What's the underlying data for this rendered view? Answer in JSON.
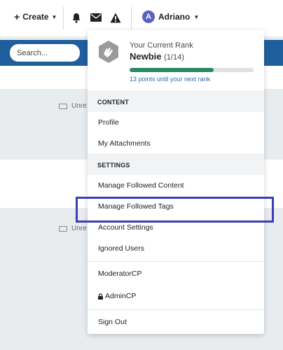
{
  "topbar": {
    "create_label": "Create",
    "username": "Adriano",
    "avatar_letter": "A"
  },
  "search": {
    "placeholder": "Search..."
  },
  "background": {
    "unread_label_1": "Unre",
    "unread_label_2": "Unre"
  },
  "rank": {
    "subtitle": "Your Current Rank",
    "name": "Newbie",
    "fraction": "(1/14)",
    "progress": 0.68,
    "next_text": "13 points until your next rank"
  },
  "menu": {
    "content_heading": "CONTENT",
    "profile": "Profile",
    "attachments": "My Attachments",
    "settings_heading": "SETTINGS",
    "followed_content": "Manage Followed Content",
    "followed_tags": "Manage Followed Tags",
    "account_settings": "Account Settings",
    "ignored_users": "Ignored Users",
    "moderator_cp": "ModeratorCP",
    "admin_cp": "AdminCP",
    "sign_out": "Sign Out"
  },
  "colors": {
    "accent_blue": "#1f5f9e",
    "progress_green": "#2a8a63",
    "highlight": "#3a3fb6",
    "avatar": "#5a62c2"
  },
  "icons": [
    "plus-icon",
    "caret-down-icon",
    "bell-icon",
    "envelope-icon",
    "warning-icon",
    "rank-badge-icon",
    "keyboard-icon",
    "lock-icon"
  ]
}
